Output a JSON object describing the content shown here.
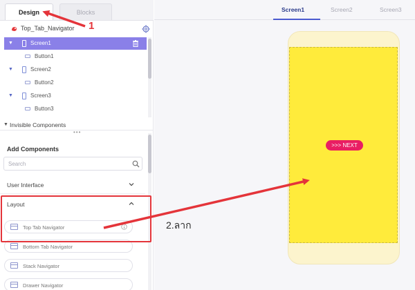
{
  "top_tabs": {
    "design": "Design",
    "blocks": "Blocks"
  },
  "tree": {
    "app_name": "Top_Tab_Navigator",
    "items": [
      {
        "label": "Screen1",
        "kind": "screen",
        "selected": true
      },
      {
        "label": "Button1",
        "kind": "button"
      },
      {
        "label": "Screen2",
        "kind": "screen"
      },
      {
        "label": "Button2",
        "kind": "button"
      },
      {
        "label": "Screen3",
        "kind": "screen"
      },
      {
        "label": "Button3",
        "kind": "button"
      }
    ],
    "invisible_components": "Invisible Components"
  },
  "add_components": {
    "title": "Add Components",
    "search_placeholder": "Search",
    "sections": {
      "user_interface": "User Interface",
      "layout": "Layout"
    },
    "layout_items": [
      "Top Tab Navigator",
      "Bottom Tab Navigator",
      "Stack Navigator",
      "Drawer Navigator"
    ]
  },
  "screen_tabs": [
    "Screen1",
    "Screen2",
    "Screen3"
  ],
  "preview": {
    "button_label": ">>> NEXT"
  },
  "annotations": {
    "step1": "1",
    "step2": "2.ลาก"
  },
  "colors": {
    "selection": "#8a80e8",
    "preview_screen": "#ffeb3b",
    "next_button": "#e91e63",
    "annotation_red": "#e4343a",
    "active_tab": "#4a5ad0"
  }
}
